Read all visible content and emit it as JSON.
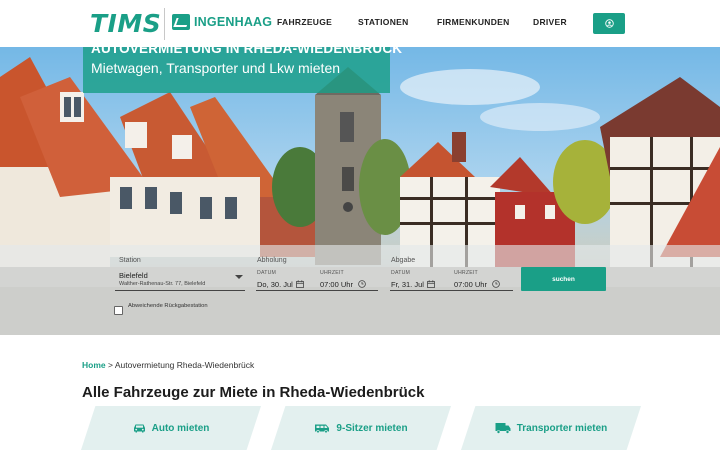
{
  "header": {
    "logo": "TIMS",
    "partner": "INGENHAAG",
    "nav": [
      "FAHRZEUGE",
      "STATIONEN",
      "FIRMENKUNDEN",
      "DRIVER"
    ],
    "account_icon": "user-icon"
  },
  "hero": {
    "title": "AUTOVERMIETUNG IN RHEDA-WIEDENBRÜCK",
    "subtitle": "Mietwagen, Transporter und Lkw mieten"
  },
  "booking": {
    "station_label": "Station",
    "station_value": "Bielefeld",
    "station_address": "Walther-Rathenau-Str. 77, Bielefeld",
    "pickup_label": "Abholung",
    "return_label": "Abgabe",
    "date_label": "DATUM",
    "time_label": "UHRZEIT",
    "pickup_date": "Do, 30. Jul",
    "pickup_time": "07:00 Uhr",
    "return_date": "Fr, 31. Jul",
    "return_time": "07:00 Uhr",
    "search_label": "suchen",
    "diff_return_label": "Abweichende Rückgabestation",
    "diff_return_checked": false
  },
  "breadcrumb": {
    "home": "Home",
    "separator": ">",
    "current": "Autovermietung Rheda-Wiedenbrück"
  },
  "main": {
    "heading": "Alle Fahrzeuge zur Miete in Rheda-Wiedenbrück",
    "categories": [
      {
        "label": "Auto mieten",
        "icon": "car-icon"
      },
      {
        "label": "9-Sitzer mieten",
        "icon": "van-icon"
      },
      {
        "label": "Transporter mieten",
        "icon": "truck-icon"
      }
    ]
  },
  "colors": {
    "accent": "#1a9f87",
    "card_bg": "#e3f0ef"
  }
}
